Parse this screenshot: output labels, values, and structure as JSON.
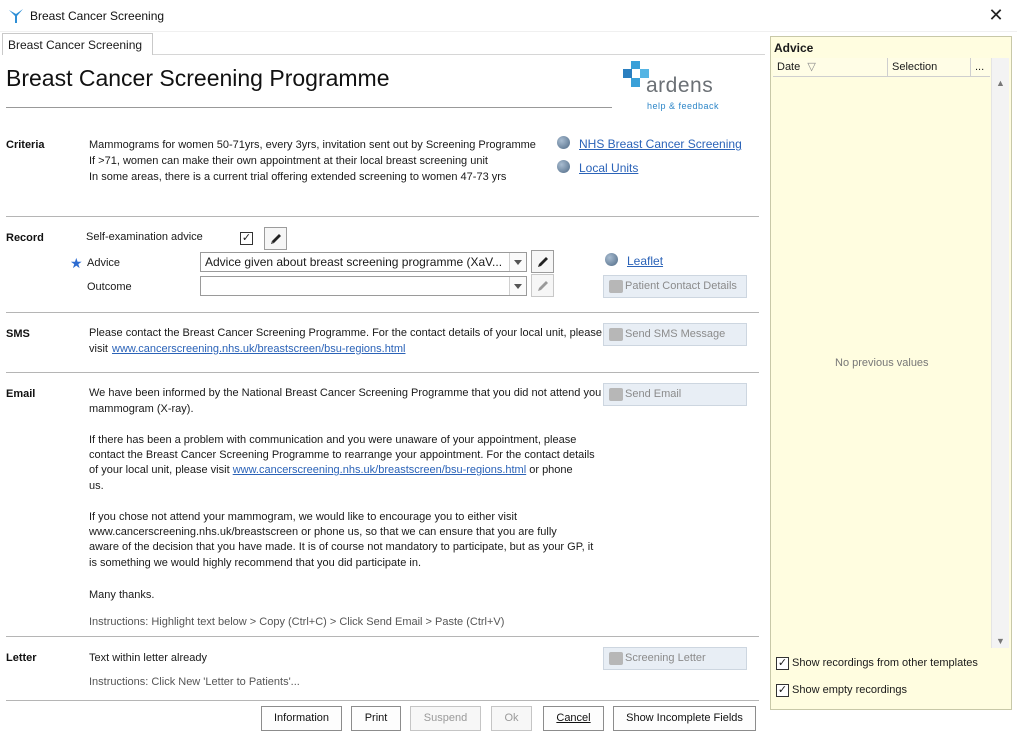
{
  "window": {
    "title": "Breast Cancer Screening"
  },
  "tab": {
    "label": "Breast Cancer Screening"
  },
  "main": {
    "title": "Breast Cancer Screening Programme",
    "logo": {
      "text": "ardens",
      "subtitle": "help & feedback"
    }
  },
  "criteria": {
    "label": "Criteria",
    "lines": [
      "Mammograms for women 50-71yrs, every 3yrs, invitation sent out by Screening Programme",
      "If >71, women can make their own appointment at their local breast screening unit",
      "In some areas, there is a current trial offering extended screening to women 47-73 yrs"
    ],
    "links": [
      "NHS Breast Cancer Screening",
      "Local Units"
    ]
  },
  "record": {
    "label": "Record",
    "self_exam_label": "Self-examination advice",
    "self_exam_checked": true,
    "advice_label": "Advice",
    "advice_value": "Advice given about breast screening programme (XaV...",
    "outcome_label": "Outcome",
    "outcome_value": "",
    "leaflet_link": "Leaflet",
    "patient_contact_button": "Patient Contact Details"
  },
  "sms": {
    "label": "SMS",
    "text": "Please contact the Breast Cancer Screening Programme. For the contact details of your local unit, please",
    "text_visit": "visit",
    "link": "www.cancerscreening.nhs.uk/breastscreen/bsu-regions.html",
    "button": "Send SMS Message"
  },
  "email": {
    "label": "Email",
    "p1_l1": "We have been informed by the National Breast Cancer Screening Programme that you did not attend you",
    "p1_l2": "mammogram (X-ray).",
    "p2_l1": "If there has been a problem with communication and you were unaware of your appointment, please",
    "p2_l2": "contact the Breast Cancer Screening Programme to rearrange your appointment. For the contact details",
    "p2_l3_pre": "of your local unit, please visit ",
    "p2_l3_link": "www.cancerscreening.nhs.uk/breastscreen/bsu-regions.html",
    "p2_l3_post": " or phone",
    "p2_l4": "us.",
    "p3_l1": "If you chose not attend your mammogram, we would like to encourage you to either visit",
    "p3_l2": "www.cancerscreening.nhs.uk/breastscreen or phone us, so that we can ensure that you are fully",
    "p3_l3": "aware of the decision that you have made. It is of course not mandatory to participate, but as your GP, it",
    "p3_l4": "is something we would highly recommend that you did participate in.",
    "thanks": "Many thanks.",
    "instructions": "Instructions: Highlight text below > Copy (Ctrl+C) > Click Send Email > Paste (Ctrl+V)",
    "button": "Send Email"
  },
  "letter": {
    "label": "Letter",
    "text": "Text within letter already",
    "instructions": "Instructions: Click New 'Letter to Patients'...",
    "button": "Screening Letter"
  },
  "advice_panel": {
    "title": "Advice",
    "col_date": "Date",
    "col_selection": "Selection",
    "col_more": "...",
    "empty_text": "No previous values",
    "show_other_templates": "Show recordings from other templates",
    "show_empty": "Show empty recordings",
    "show_other_checked": true,
    "show_empty_checked": true
  },
  "footer": {
    "information": "Information",
    "print": "Print",
    "suspend": "Suspend",
    "ok": "Ok",
    "cancel": "Cancel",
    "show_incomplete": "Show Incomplete Fields"
  },
  "colors": {
    "link": "#2b63b8",
    "advice_bg": "#fffde0",
    "star": "#2d6cd1",
    "logo_blue": "#2d86c8"
  }
}
